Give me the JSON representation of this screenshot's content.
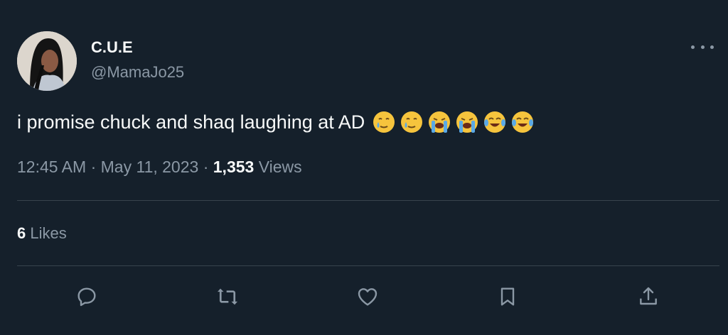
{
  "tweet": {
    "author_name": "C.U.E",
    "handle": "@MamaJo25",
    "text": "i promise chuck and shaq laughing at AD",
    "emojis": [
      "face-holding-back-tears",
      "face-holding-back-tears",
      "loudly-crying-face",
      "loudly-crying-face",
      "face-with-tears-of-joy",
      "face-with-tears-of-joy"
    ],
    "time": "12:45 AM",
    "separator": "·",
    "date": "May 11, 2023",
    "views_count": "1,353",
    "views_label": "Views",
    "likes_count": "6",
    "likes_label": "Likes"
  },
  "actions": [
    "reply-icon",
    "retweet-icon",
    "like-icon",
    "bookmark-icon",
    "share-icon"
  ],
  "colors": {
    "background": "#15202b",
    "primary_text": "#f7f9f9",
    "secondary_text": "#8b98a5",
    "divider": "#38444d"
  }
}
